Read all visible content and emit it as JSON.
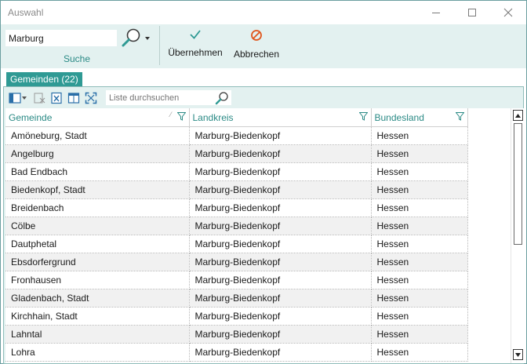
{
  "window": {
    "title": "Auswahl"
  },
  "ribbon": {
    "search_value": "Marburg",
    "search_group_label": "Suche",
    "accept_label": "Übernehmen",
    "cancel_label": "Abbrechen"
  },
  "tab": {
    "label": "Gemeinden (22)"
  },
  "list": {
    "search_placeholder": "Liste durchsuchen",
    "columns": [
      "Gemeinde",
      "Landkreis",
      "Bundesland"
    ],
    "rows": [
      [
        "Amöneburg, Stadt",
        "Marburg-Biedenkopf",
        "Hessen"
      ],
      [
        "Angelburg",
        "Marburg-Biedenkopf",
        "Hessen"
      ],
      [
        "Bad Endbach",
        "Marburg-Biedenkopf",
        "Hessen"
      ],
      [
        "Biedenkopf, Stadt",
        "Marburg-Biedenkopf",
        "Hessen"
      ],
      [
        "Breidenbach",
        "Marburg-Biedenkopf",
        "Hessen"
      ],
      [
        "Cölbe",
        "Marburg-Biedenkopf",
        "Hessen"
      ],
      [
        "Dautphetal",
        "Marburg-Biedenkopf",
        "Hessen"
      ],
      [
        "Ebsdorfergrund",
        "Marburg-Biedenkopf",
        "Hessen"
      ],
      [
        "Fronhausen",
        "Marburg-Biedenkopf",
        "Hessen"
      ],
      [
        "Gladenbach, Stadt",
        "Marburg-Biedenkopf",
        "Hessen"
      ],
      [
        "Kirchhain, Stadt",
        "Marburg-Biedenkopf",
        "Hessen"
      ],
      [
        "Lahntal",
        "Marburg-Biedenkopf",
        "Hessen"
      ],
      [
        "Lohra",
        "Marburg-Biedenkopf",
        "Hessen"
      ]
    ]
  },
  "colors": {
    "accent": "#2f9a94",
    "ribbon_bg": "#e3f1f0",
    "header_text": "#2a8a85",
    "cancel_icon": "#e0561c"
  },
  "icons": {
    "minimize": "minimize-icon",
    "maximize": "maximize-icon",
    "close": "close-icon",
    "search": "magnifier-icon",
    "accept": "checkmark-icon",
    "cancel": "prohibited-icon"
  }
}
